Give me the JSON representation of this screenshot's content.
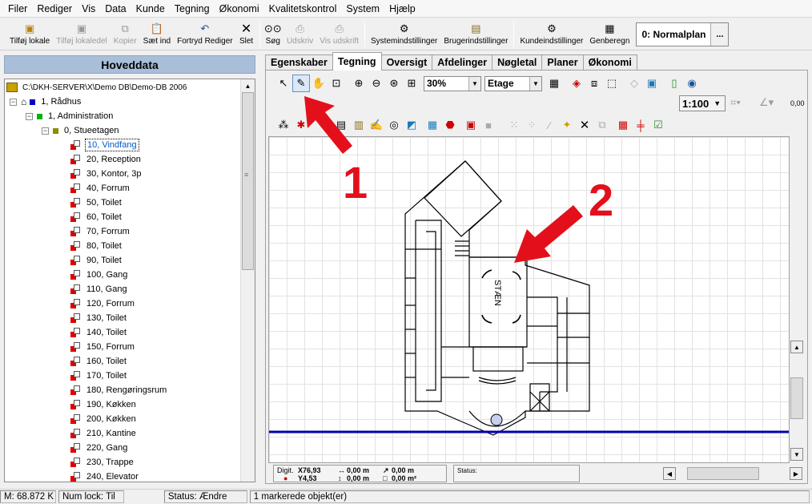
{
  "menu": [
    "Filer",
    "Rediger",
    "Vis",
    "Data",
    "Kunde",
    "Tegning",
    "Økonomi",
    "Kvalitetskontrol",
    "System",
    "Hjælp"
  ],
  "toolbar": {
    "buttons": [
      {
        "label": "Tilføj lokale",
        "icon": "add-room-icon",
        "enabled": true
      },
      {
        "label": "Tilføj lokaledel",
        "icon": "add-room-part-icon",
        "enabled": false
      },
      {
        "label": "Kopier",
        "icon": "copy-icon",
        "enabled": false
      },
      {
        "label": "Sæt ind",
        "icon": "paste-icon",
        "enabled": true
      },
      {
        "label": "Fortryd Rediger",
        "icon": "undo-icon",
        "enabled": true
      },
      {
        "label": "Slet",
        "icon": "delete-icon",
        "enabled": true
      },
      {
        "label": "Søg",
        "icon": "binoculars-icon",
        "enabled": true
      },
      {
        "label": "Udskriv",
        "icon": "print-icon",
        "enabled": false
      },
      {
        "label": "Vis udskrift",
        "icon": "print-preview-icon",
        "enabled": false
      },
      {
        "label": "Systemindstillinger",
        "icon": "system-settings-icon",
        "enabled": true
      },
      {
        "label": "Brugerindstillinger",
        "icon": "user-settings-icon",
        "enabled": true
      },
      {
        "label": "Kundeindstillinger",
        "icon": "customer-settings-icon",
        "enabled": true
      },
      {
        "label": "Genberegn",
        "icon": "recalculate-icon",
        "enabled": true
      }
    ],
    "plan_select": "0: Normalplan",
    "plan_dots": "..."
  },
  "left_panel": {
    "title": "Hoveddata",
    "root": "C:\\DKH-SERVER\\X\\Demo DB\\Demo-DB 2006",
    "building": "1, Rådhus",
    "department": "1, Administration",
    "floor": "0, Stueetagen",
    "rooms": [
      "10, Vindfang",
      "20, Reception",
      "30, Kontor, 3p",
      "40, Forrum",
      "50, Toilet",
      "60, Toilet",
      "70, Forrum",
      "80, Toilet",
      "90, Toilet",
      "100, Gang",
      "110, Gang",
      "120, Forrum",
      "130, Toilet",
      "140, Toilet",
      "150, Forrum",
      "160, Toilet",
      "170, Toilet",
      "180, Rengøringsrum",
      "190, Køkken",
      "200, Køkken",
      "210, Kantine",
      "220, Gang",
      "230, Trappe",
      "240, Elevator"
    ],
    "selected_room": "10, Vindfang"
  },
  "tabs": [
    "Egenskaber",
    "Tegning",
    "Oversigt",
    "Afdelinger",
    "Nøgletal",
    "Planer",
    "Økonomi"
  ],
  "active_tab": "Tegning",
  "drawing": {
    "zoom": "30%",
    "layer": "Etage",
    "scale": "1:100",
    "snap_value": "0,00",
    "stair_label": "STÆN"
  },
  "coords": {
    "digit_label": "Digit.",
    "x": "X76,93",
    "y": "Y4,53",
    "len1": "0,00 m",
    "len2": "0,00 m",
    "area_len": "0,00 m",
    "area": "0,00 m²"
  },
  "status_label": "Status:",
  "annotations": {
    "one": "1",
    "two": "2"
  },
  "statusbar": {
    "m": "M: 68.872 K",
    "numlock": "Num lock: Til",
    "status": "Status: Ændre",
    "selection": "1 markerede objekt(er)"
  },
  "colors": {
    "annotation": "#e3101c",
    "header": "#a9bfd9",
    "selected_text": "#0058c8"
  }
}
